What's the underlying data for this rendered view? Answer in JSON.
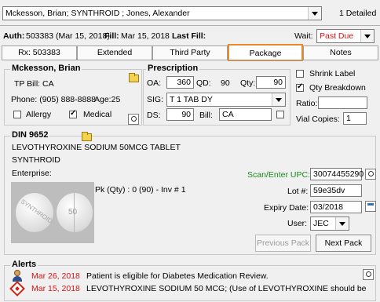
{
  "header": {
    "patient_select": "Mckesson, Brian; SYNTHROID ; Jones, Alexander",
    "detail_count": "1 Detailed"
  },
  "rx_line": {
    "auth_label": "Auth:",
    "auth_value": "503383 (Mar 15, 2018)",
    "fill_label": "Fill:",
    "fill_value": "Mar 15, 2018",
    "last_fill_label": "Last Fill:",
    "wait_label": "Wait:",
    "wait_value": "Past Due"
  },
  "tabs": [
    {
      "label": "Rx: 503383",
      "active": false
    },
    {
      "label": "Extended",
      "active": false
    },
    {
      "label": "Third Party",
      "active": false
    },
    {
      "label": "Package",
      "active": true
    },
    {
      "label": "Notes",
      "active": false
    }
  ],
  "patient": {
    "name": "Mckesson, Brian",
    "tp_bill": "TP Bill: CA",
    "phone": "Phone: (905) 888-8888",
    "age": "Age:25",
    "allergy_label": "Allergy",
    "allergy_checked": false,
    "medical_label": "Medical",
    "medical_checked": true
  },
  "prescription": {
    "title": "Prescription",
    "oa_label": "OA:",
    "oa_value": "360",
    "qd_label": "QD:",
    "qd_value": "90",
    "qty_label": "Qty:",
    "qty_value": "90",
    "sig_label": "SIG:",
    "sig_value": "T 1 TAB DY",
    "ds_label": "DS:",
    "ds_value": "90",
    "bill_label": "Bill:",
    "bill_value": "CA"
  },
  "options": {
    "shrink_label": "Shrink Label",
    "shrink_checked": false,
    "qty_breakdown": "Qty Breakdown",
    "qty_breakdown_checked": true,
    "ratio_label": "Ratio:",
    "ratio_value": "",
    "vial_label": "Vial Copies:",
    "vial_value": "1"
  },
  "drug": {
    "din": "DIN 9652",
    "name": "LEVOTHYROXINE SODIUM 50MCG TABLET",
    "brand": "SYNTHROID",
    "enterprise_label": "Enterprise:",
    "pk": "Pk (Qty) : 0 (90) -  Inv # 1",
    "pill_text_1": "SYNTHROID",
    "pill_text_2": "50",
    "upc_label": "Scan/Enter UPC:",
    "upc_value": "30074455290",
    "lot_label": "Lot #:",
    "lot_value": "59e35dv",
    "expiry_label": "Expiry Date:",
    "expiry_value": "03/2018",
    "user_label": "User:",
    "user_value": "JEC",
    "prev_pack": "Previous Pack",
    "next_pack": "Next Pack"
  },
  "alerts": {
    "title": "Alerts",
    "items": [
      {
        "date": "Mar 26, 2018",
        "text": "Patient is eligible for Diabetes Medication Review."
      },
      {
        "date": "Mar 15, 2018",
        "text": "LEVOTHYROXINE SODIUM 50 MCG; (Use of LEVOTHYROXINE should be"
      }
    ]
  },
  "colors": {
    "active_tab_border": "#e8892a",
    "wait_red": "#d11111",
    "upc_green": "#1a8a1a",
    "alert_date_red": "#d11111"
  }
}
